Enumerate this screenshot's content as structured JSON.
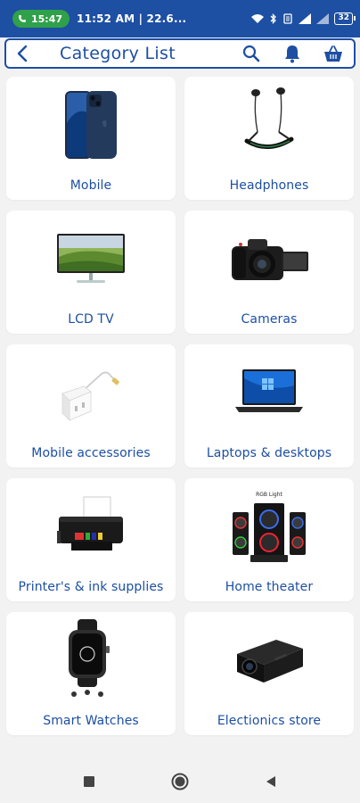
{
  "status_bar": {
    "call_time": "15:47",
    "time_text": "11:52 AM | 22.6...",
    "battery": "32"
  },
  "app_bar": {
    "title": "Category List"
  },
  "categories": [
    {
      "label": "Mobile",
      "icon": "smartphone-image"
    },
    {
      "label": "Headphones",
      "icon": "headphones-image"
    },
    {
      "label": "LCD TV",
      "icon": "monitor-image"
    },
    {
      "label": "Cameras",
      "icon": "camera-image"
    },
    {
      "label": "Mobile accessories",
      "icon": "charger-image"
    },
    {
      "label": "Laptops & desktops",
      "icon": "laptop-image"
    },
    {
      "label": "Printer's & ink supplies",
      "icon": "printer-image"
    },
    {
      "label": "Home theater",
      "icon": "speakers-image",
      "image_caption": "RGB Light"
    },
    {
      "label": "Smart Watches",
      "icon": "smartwatch-image"
    },
    {
      "label": "Electionics store",
      "icon": "projector-image"
    }
  ],
  "colors": {
    "brand": "#1d4fa3",
    "call_green": "#2fa14a",
    "background": "#f2f2f2"
  }
}
